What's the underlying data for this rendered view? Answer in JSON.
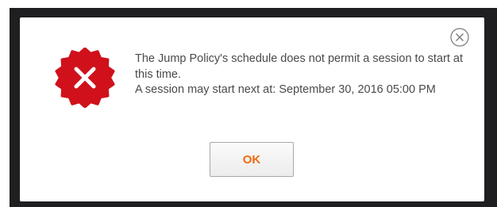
{
  "dialog": {
    "message_line1": "The Jump Policy's schedule does not permit a session to start at this time.",
    "message_line2": "A session may start next at: September 30, 2016 05:00 PM",
    "ok_label": "OK"
  },
  "icons": {
    "status": "error-x-icon",
    "close": "close-circle-icon"
  },
  "colors": {
    "error_red": "#d0111b",
    "ok_text": "#f06a10",
    "backdrop": "#1f1f21"
  }
}
